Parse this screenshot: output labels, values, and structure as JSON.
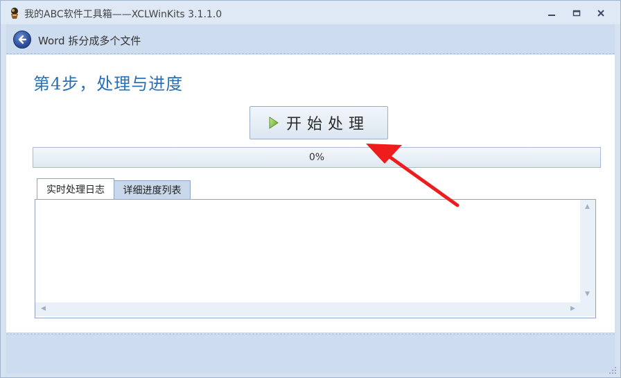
{
  "window": {
    "title": "我的ABC软件工具箱——XCLWinKits  3.1.1.0",
    "controls": [
      "minimize-icon",
      "maximize-icon",
      "close-icon"
    ]
  },
  "header": {
    "title": "Word 拆分成多个文件",
    "back_icon": "back-arrow-icon"
  },
  "step": {
    "title": "第4步，处理与进度"
  },
  "start_button": {
    "label": "开始处理",
    "icon": "play-icon",
    "icon_color": "#7bbf3a"
  },
  "progress": {
    "percent": 0,
    "text": "0%"
  },
  "tabs": [
    {
      "label": "实时处理日志",
      "active": true
    },
    {
      "label": "详细进度列表",
      "active": false
    }
  ],
  "log": {
    "value": ""
  },
  "colors": {
    "accent": "#2a70b4",
    "annotation_arrow": "#ee1c1c"
  }
}
